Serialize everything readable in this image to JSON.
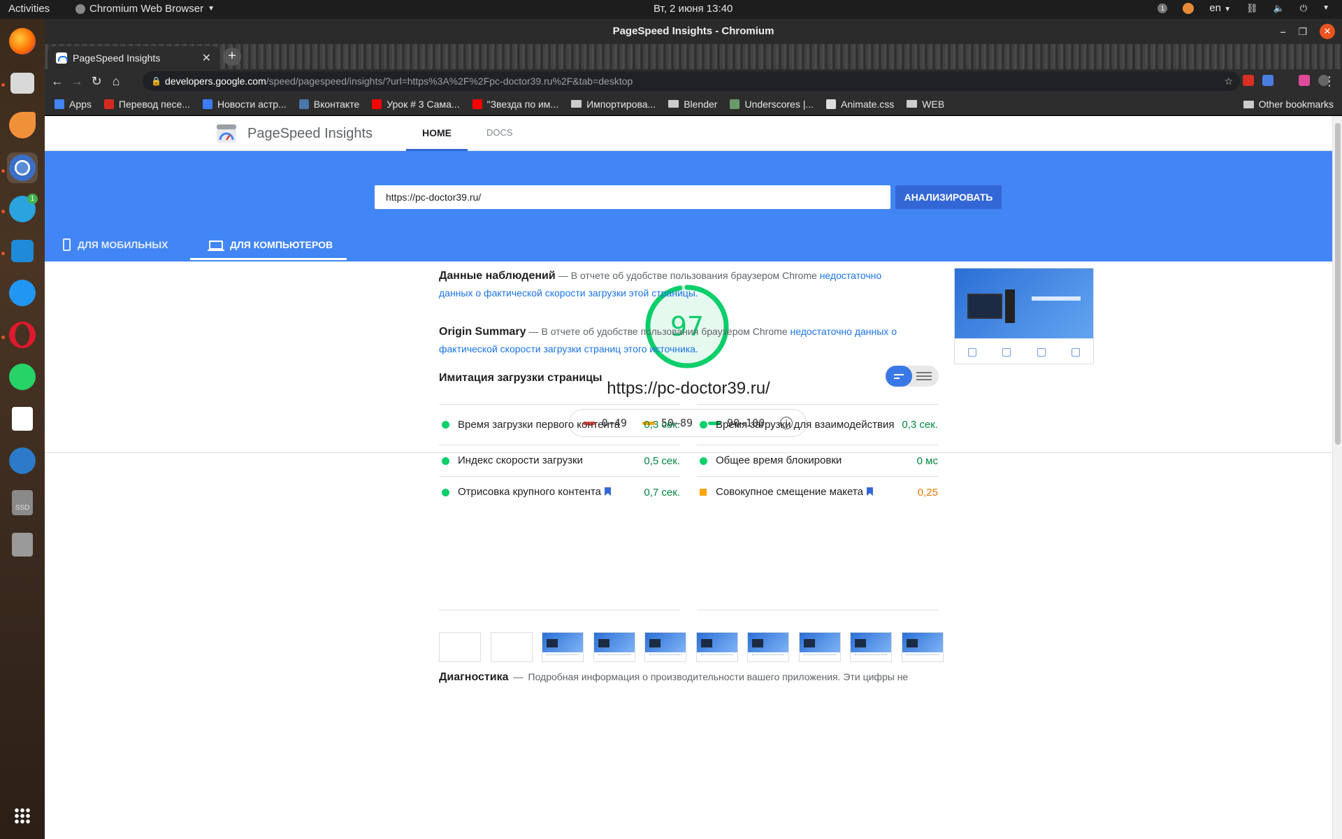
{
  "os": {
    "activities": "Activities",
    "app_menu": "Chromium Web Browser",
    "clock": "Вт, 2 июня  13:40",
    "input_lang": "en",
    "tray_badge": "1"
  },
  "dock": {
    "telegram_badge": "1",
    "ssd_label": "SSD"
  },
  "window": {
    "title": "PageSpeed Insights - Chromium"
  },
  "browser": {
    "tab_title": "PageSpeed Insights",
    "url_host": "developers.google.com",
    "url_path": "/speed/pagespeed/insights/?url=https%3A%2F%2Fpc-doctor39.ru%2F&tab=desktop",
    "bookmarks": [
      {
        "label": "Apps",
        "icon": "apps-grid-icon",
        "color": "#4285f4"
      },
      {
        "label": "Перевод песе...",
        "icon": "russia-flag-icon",
        "color": "#d52b1e"
      },
      {
        "label": "Новости астр...",
        "icon": "chevron-icon",
        "color": "#3d7bff"
      },
      {
        "label": "Вконтакте",
        "icon": "vk-icon",
        "color": "#4a76a8"
      },
      {
        "label": "Урок # 3 Сама...",
        "icon": "youtube-icon",
        "color": "#ff0000"
      },
      {
        "label": "\"Звезда по им...",
        "icon": "youtube-icon",
        "color": "#ff0000"
      },
      {
        "label": "Импортирова...",
        "icon": "folder-icon",
        "color": "#cccccc"
      },
      {
        "label": "Blender",
        "icon": "folder-icon",
        "color": "#cccccc"
      },
      {
        "label": "Underscores |...",
        "icon": "underscores-icon",
        "color": "#6a9a6a"
      },
      {
        "label": "Animate.css",
        "icon": "animate-icon",
        "color": "#dddddd"
      },
      {
        "label": "WEB",
        "icon": "folder-icon",
        "color": "#cccccc"
      }
    ],
    "other_bookmarks": "Other bookmarks"
  },
  "psi": {
    "brand": "PageSpeed Insights",
    "nav_home": "HOME",
    "nav_docs": "DOCS",
    "url_value": "https://pc-doctor39.ru/",
    "analyze": "АНАЛИЗИРОВАТЬ",
    "tab_mobile": "ДЛЯ МОБИЛЬНЫХ",
    "tab_desktop": "ДЛЯ КОМПЬЮТЕРОВ",
    "score": "97",
    "score_value": 97,
    "score_color": "#0cce6b",
    "tested_url": "https://pc-doctor39.ru/",
    "legend": [
      {
        "label": "0–49",
        "color": "#ff4e42"
      },
      {
        "label": "50–89",
        "color": "#ffa400"
      },
      {
        "label": "90–100",
        "color": "#0cce6b"
      }
    ],
    "field_data": {
      "title": "Данные наблюдений",
      "text": "В отчете об удобстве пользования браузером Chrome",
      "link": "недостаточно данных о фактической скорости загрузки этой страницы."
    },
    "origin_summary": {
      "title": "Origin Summary",
      "text": "В отчете об удобстве пользования браузером Chrome",
      "link": "недостаточно данных о фактической скорости загрузки страниц этого источника."
    },
    "lab_title": "Имитация загрузки страницы",
    "metrics_left": [
      {
        "name": "Время загрузки первого контента",
        "value": "0,3 сек.",
        "status": "good",
        "flag": false
      },
      {
        "name": "Индекс скорости загрузки",
        "value": "0,5 сек.",
        "status": "good",
        "flag": false
      },
      {
        "name": "Отрисовка крупного контента",
        "value": "0,7 сек.",
        "status": "good",
        "flag": true
      }
    ],
    "metrics_right": [
      {
        "name": "Время загрузки для взаимодействия",
        "value": "0,3 сек.",
        "status": "good",
        "flag": false
      },
      {
        "name": "Общее время блокировки",
        "value": "0 мс",
        "status": "good",
        "flag": false
      },
      {
        "name": "Совокупное смещение макета",
        "value": "0,25",
        "status": "average",
        "flag": true
      }
    ],
    "diagnostics": {
      "title": "Диагностика",
      "text": "Подробная информация о производительности вашего приложения. Эти цифры не"
    }
  }
}
